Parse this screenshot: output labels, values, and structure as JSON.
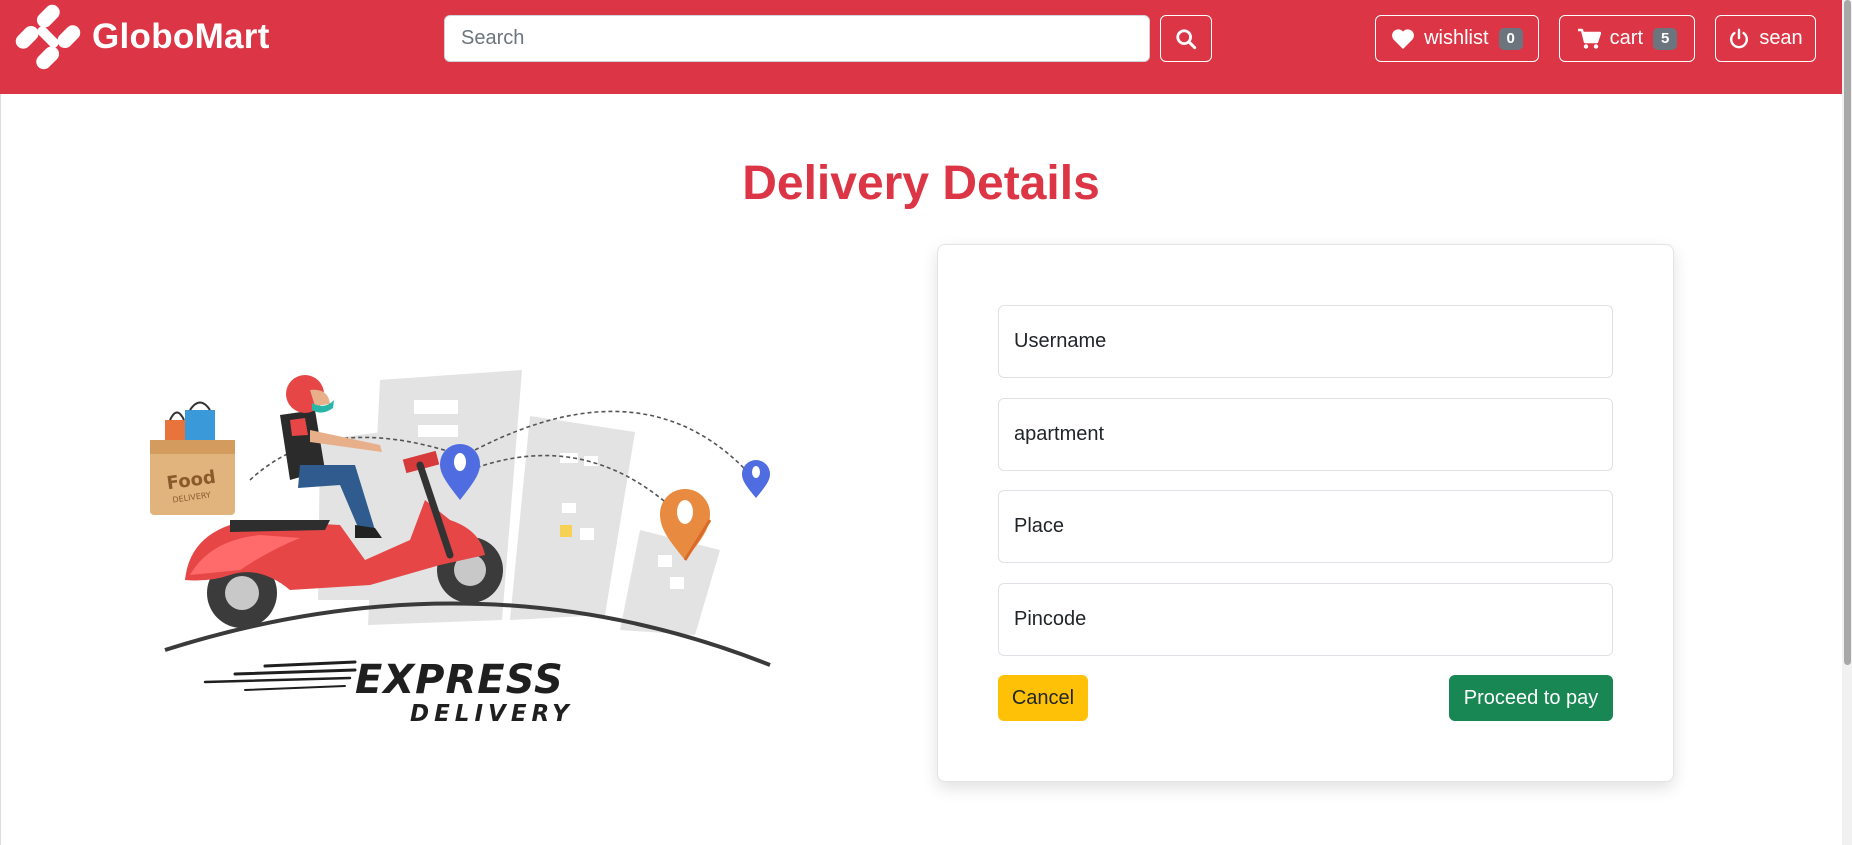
{
  "navbar": {
    "brand": "GloboMart",
    "search_placeholder": "Search",
    "wishlist": {
      "label": "wishlist",
      "count": "0"
    },
    "cart": {
      "label": "cart",
      "count": "5"
    },
    "user": {
      "label": "sean"
    }
  },
  "page": {
    "title": "Delivery Details"
  },
  "illustration": {
    "box_text_1": "Food",
    "box_text_2": "DELIVERY",
    "caption_1": "EXPRESS",
    "caption_2": "DELIVERY"
  },
  "form": {
    "username_placeholder": "Username",
    "apartment_placeholder": "apartment",
    "place_placeholder": "Place",
    "pincode_placeholder": "Pincode",
    "cancel_label": "Cancel",
    "proceed_label": "Proceed to pay"
  },
  "colors": {
    "brand_red": "#dc3545",
    "cancel_yellow": "#ffc107",
    "proceed_green": "#198754",
    "badge_gray": "#6c757d"
  }
}
